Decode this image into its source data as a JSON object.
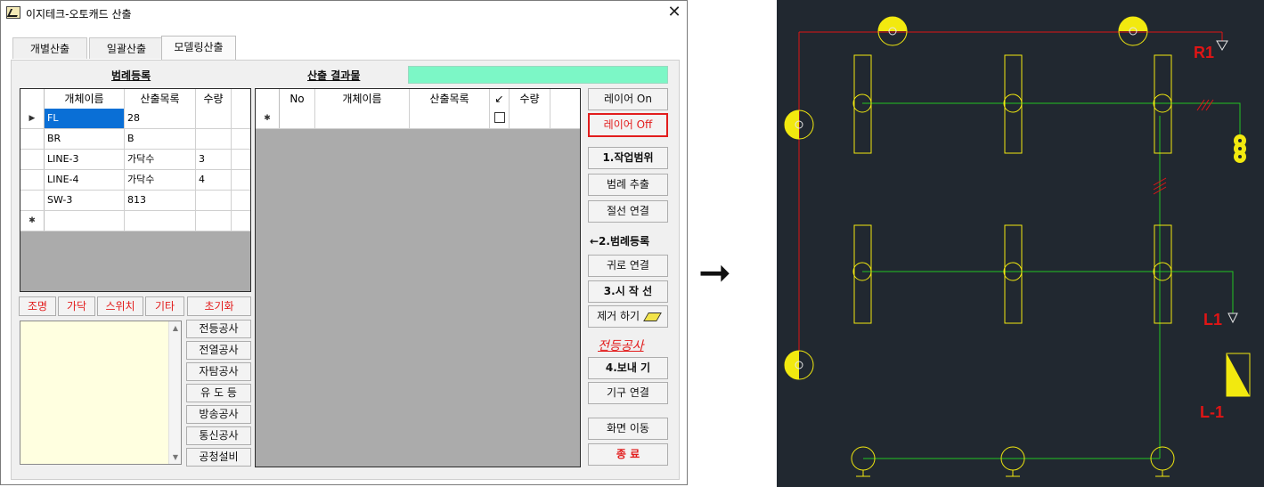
{
  "window": {
    "title": "이지테크-오토캐드 산출",
    "close_glyph": "✕"
  },
  "tabs": [
    "개별산출",
    "일괄산출",
    "모델링산출"
  ],
  "legend_section": {
    "title": "범례등록",
    "columns": [
      "개체이름",
      "산출목록",
      "수량"
    ],
    "rows": [
      {
        "name": "FL",
        "item": "28",
        "qty": ""
      },
      {
        "name": "BR",
        "item": "B",
        "qty": ""
      },
      {
        "name": "LINE-3",
        "item": "가닥수",
        "qty": "3"
      },
      {
        "name": "LINE-4",
        "item": "가닥수",
        "qty": "4"
      },
      {
        "name": "SW-3",
        "item": "813",
        "qty": ""
      }
    ],
    "current_marker": "▶",
    "new_marker": "✱"
  },
  "result_section": {
    "title": "산출 결과물",
    "accent_color": "#7cf7c6",
    "columns": [
      "No",
      "개체이름",
      "산출목록",
      "↙",
      "수량"
    ],
    "new_marker": "✱"
  },
  "category_buttons": [
    "조명",
    "가닥",
    "스위치",
    "기타",
    "초기화"
  ],
  "work_buttons": [
    "전등공사",
    "전열공사",
    "자탐공사",
    "유 도 등",
    "방송공사",
    "통신공사",
    "공청설비"
  ],
  "right_buttons": {
    "layer_on": "레이어 On",
    "layer_off": "레이어 Off",
    "work_range": "1.작업범위",
    "legend_extract": "범례 추출",
    "junction_connect": "절선 연결",
    "step2_label": "←2.범례등록",
    "return_connect": "귀로 연결",
    "start_line": "3.시 작 선",
    "remove": "제거 하기",
    "work_type": "전등공사",
    "export": "4.보내 기",
    "fixture_connect": "기구 연결",
    "screen_move": "화면 이동",
    "exit": "종 료"
  },
  "arrow_glyph": "➞",
  "cad": {
    "background": "#212830",
    "labels": {
      "r1": "R1",
      "l1": "L1",
      "l_1": "L-1"
    },
    "colors": {
      "red": "#e01515",
      "green": "#22c422",
      "yellow": "#f2e90f",
      "white": "#e6e6e6"
    }
  }
}
